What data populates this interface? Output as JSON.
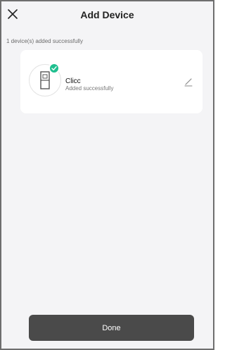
{
  "header": {
    "title": "Add Device",
    "close_icon": "close-icon"
  },
  "status": {
    "text": "1 device(s) added successfully"
  },
  "devices": [
    {
      "name": "Clicc",
      "status": "Added successfully",
      "icon": "door-sensor-icon",
      "badge_icon": "check-icon",
      "edit_icon": "pencil-icon"
    }
  ],
  "footer": {
    "done_label": "Done"
  },
  "colors": {
    "background": "#f4f4f6",
    "card": "#ffffff",
    "success": "#1fbf8f",
    "button": "#4a4a4a",
    "button_text": "#ffffff"
  }
}
